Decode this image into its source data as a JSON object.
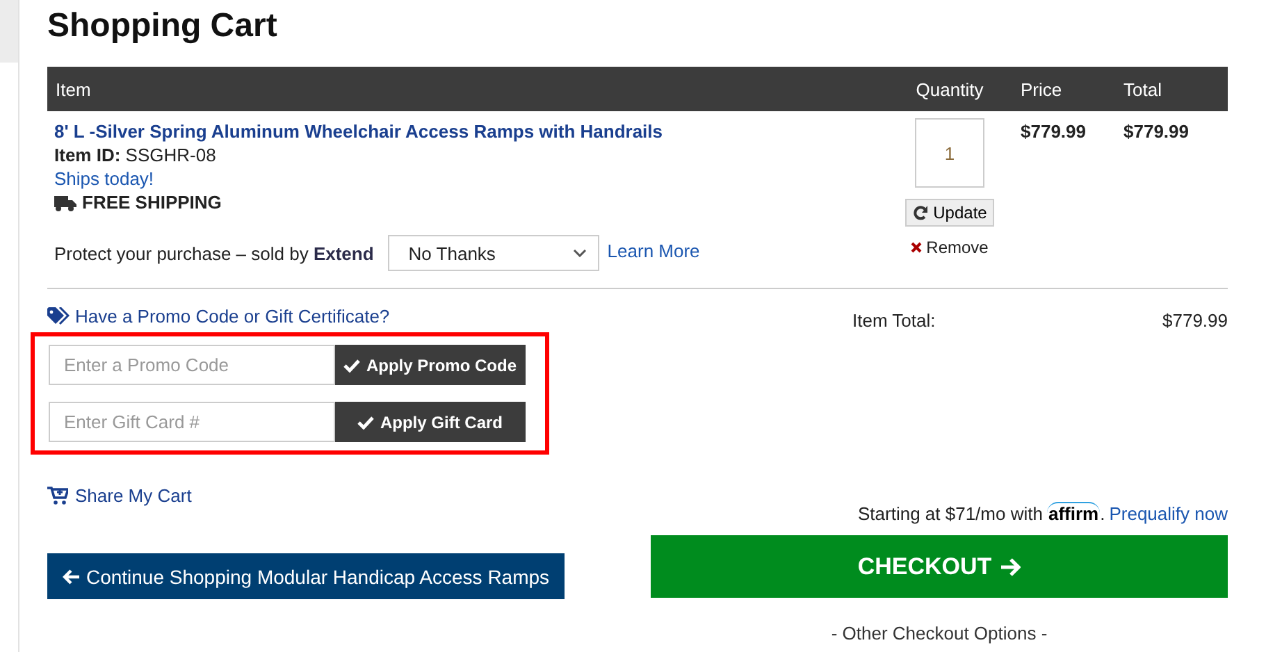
{
  "page_title": "Shopping Cart",
  "table": {
    "columns": [
      "Item",
      "Quantity",
      "Price",
      "Total"
    ],
    "rows": [
      {
        "product_name": "8' L -Silver Spring Aluminum Wheelchair Access Ramps with Handrails",
        "item_id_label": "Item ID:",
        "item_id": "SSGHR-08",
        "availability": "Ships today!",
        "shipping": "FREE SHIPPING",
        "quantity": "1",
        "update_button": "Update",
        "remove_link": "Remove",
        "price": "$779.99",
        "total": "$779.99",
        "protection_text": "Protect your purchase – sold by",
        "protection_brand": "Extend",
        "protection_select": "No Thanks",
        "learn_more": "Learn More"
      }
    ]
  },
  "promo": {
    "prompt": "Have a Promo Code or Gift Certificate?",
    "highlighted": true,
    "fields": [
      {
        "placeholder": "Enter a Promo Code",
        "button": "Apply Promo Code"
      },
      {
        "placeholder": "Enter Gift Card #",
        "button": "Apply Gift Card"
      }
    ]
  },
  "share_link": "Share My Cart",
  "continue_button": "Continue Shopping Modular Handicap Access Ramps",
  "summary": {
    "label": "Item Total:",
    "value": "$779.99"
  },
  "financing": {
    "text": "Starting at $71/mo with",
    "brand": "affirm",
    "suffix": ".",
    "link": "Prequalify now"
  },
  "checkout_button": "CHECKOUT",
  "other_options": "- Other Checkout Options -"
}
